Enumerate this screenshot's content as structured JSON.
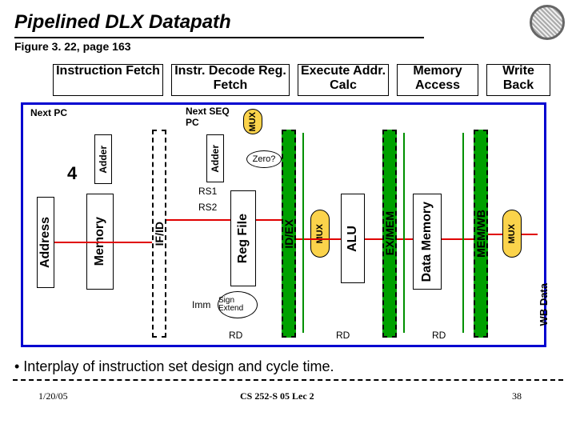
{
  "title": "Pipelined DLX Datapath",
  "subtitle": "Figure 3. 22, page 163",
  "stages": [
    "Instruction Fetch",
    "Instr. Decode Reg. Fetch",
    "Execute Addr. Calc",
    "Memory Access",
    "Write Back"
  ],
  "latches": [
    "IF/ID",
    "ID/EX",
    "EX/MEM",
    "MEM/WB"
  ],
  "blocks": {
    "address": "Address",
    "memory": "Memory",
    "adder1": "Adder",
    "adder2": "Adder",
    "regfile": "Reg File",
    "alu": "ALU",
    "datamem": "Data Memory",
    "mux": "MUX"
  },
  "labels": {
    "nextpc": "Next PC",
    "nextseqpc": "Next SEQ PC",
    "four": "4",
    "rs1": "RS1",
    "rs2": "RS2",
    "zero": "Zero?",
    "imm": "Imm",
    "signextend": "Sign Extend",
    "rd": "RD",
    "wbdata": "WB Data"
  },
  "bullet": "• Interplay of instruction set design and cycle time.",
  "footer": {
    "date": "1/20/05",
    "center": "CS 252-S 05 Lec 2",
    "page": "38"
  }
}
